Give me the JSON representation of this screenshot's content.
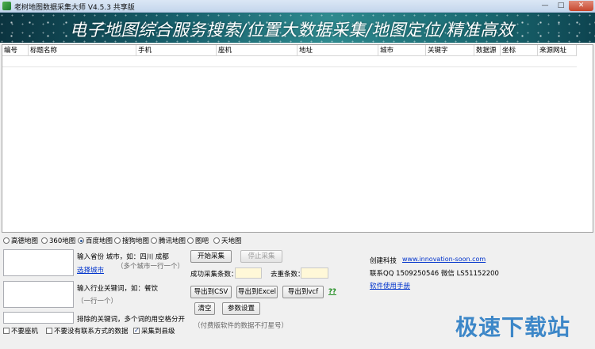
{
  "window": {
    "title": "老树地图数据采集大师 V4.5.3 共享版",
    "min": "—",
    "max": "□",
    "close": "✕"
  },
  "banner": {
    "text": "电子地图综合服务搜索/位置大数据采集/地图定位/精准高效"
  },
  "table": {
    "columns": [
      "编号",
      "标题名称",
      "手机",
      "座机",
      "地址",
      "城市",
      "关键字",
      "数据源",
      "坐标",
      "来源网址"
    ],
    "rows": []
  },
  "map_sources": {
    "options": [
      "高德地图",
      "360地图",
      "百度地图",
      "搜狗地图",
      "腾讯地图",
      "图吧",
      "天地图"
    ],
    "selected": "百度地图"
  },
  "city": {
    "hint": "输入省份 城市，如：四川 成都",
    "sub_hint": "（多个城市一行一个）",
    "select_link": "选择城市"
  },
  "keyword": {
    "hint": "输入行业关键词，如：餐饮",
    "sub_hint": "（一行一个）"
  },
  "exclude": {
    "hint": "排除的关键词，多个词的用空格分开"
  },
  "options": {
    "no_landline": {
      "label": "不要座机",
      "checked": false
    },
    "no_contact": {
      "label": "不要没有联系方式的数据",
      "checked": false
    },
    "to_county": {
      "label": "采集到县级",
      "checked": true
    }
  },
  "actions": {
    "start": "开始采集",
    "stop": "停止采集",
    "success_label": "成功采集条数：",
    "success_value": "",
    "dedup_label": "去重条数：",
    "dedup_value": "",
    "export_csv": "导出到CSV",
    "export_excel": "导出到Excel",
    "export_vcf": "导出到vcf",
    "help_mark": "??",
    "clear": "清空",
    "settings": "参数设置",
    "paid_note": "（付费版软件的数据不打星号）"
  },
  "company": {
    "name": "创建科技",
    "site": "www.innovation-soon.com",
    "contact": "联系QQ 1509250546   微信 LS51152200",
    "manual": "软件使用手册"
  },
  "watermark": "极速下载站"
}
